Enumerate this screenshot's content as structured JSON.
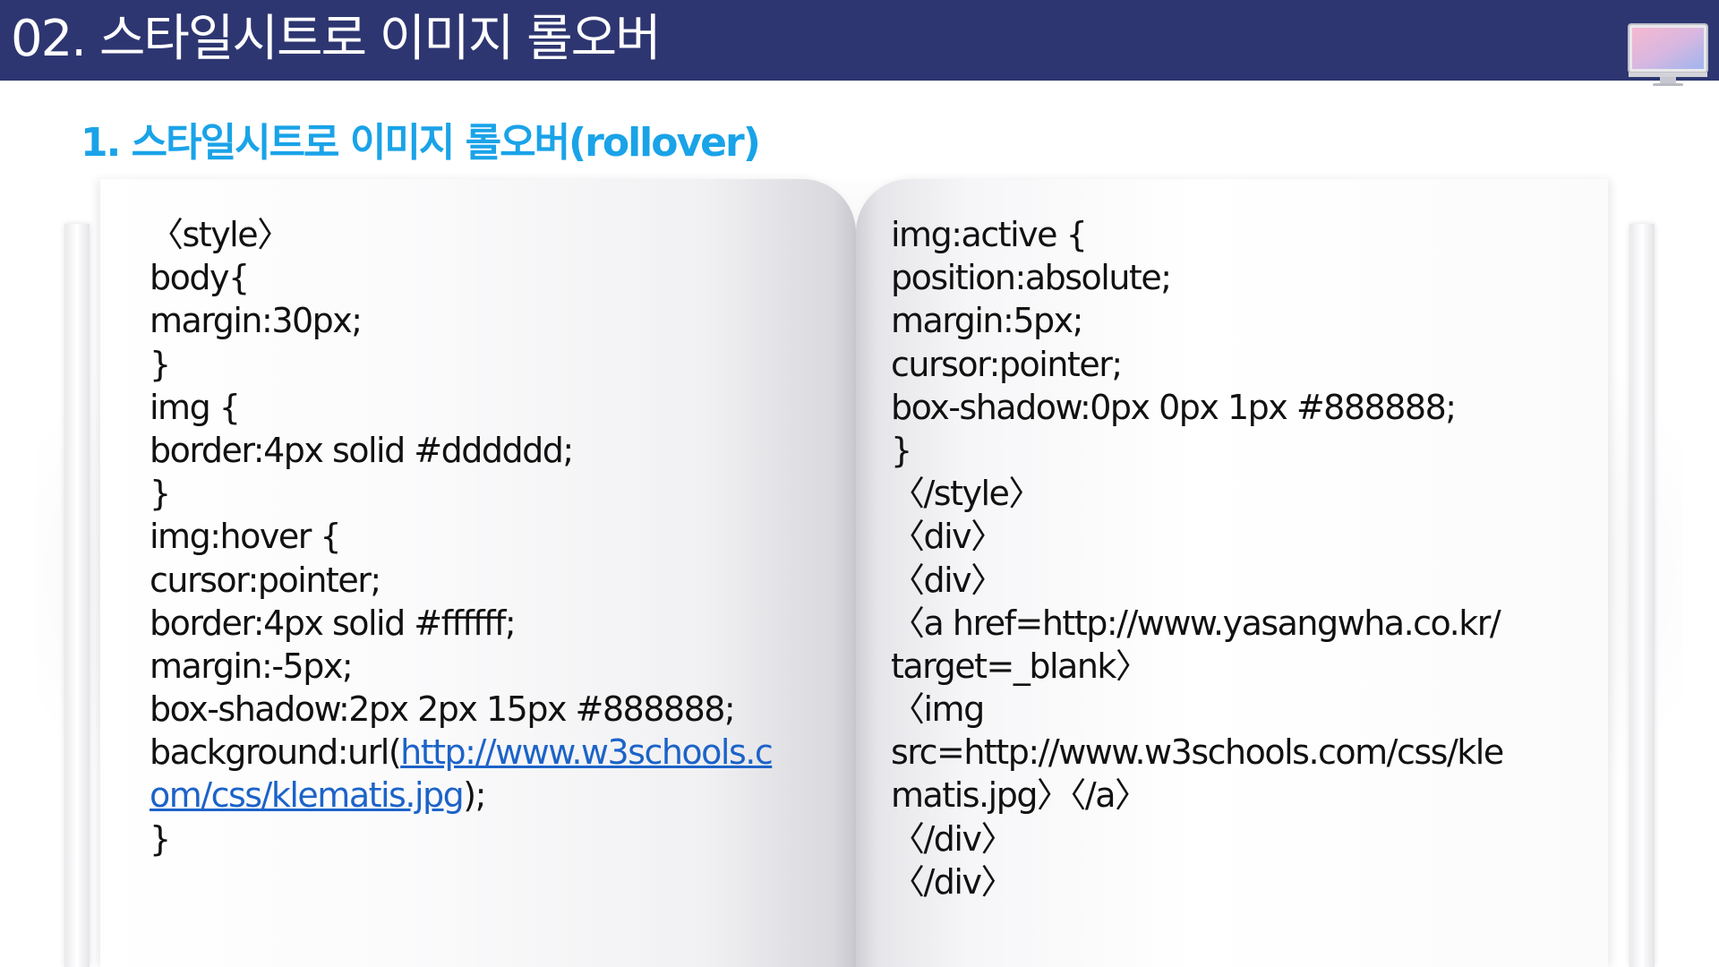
{
  "header": {
    "title": "02. 스타일시트로 이미지 롤오버",
    "icon": "monitor-icon"
  },
  "subtitle": "1. 스타일시트로 이미지 롤오버(rollover)",
  "colors": {
    "header_bg": "#2e3671",
    "subtitle": "#1aa3e8",
    "link": "#1c63c8"
  },
  "left_page": {
    "lines": [
      "〈style〉",
      "body{",
      "margin:30px;",
      "}",
      "img {",
      "border:4px solid #dddddd;",
      "}",
      "img:hover {",
      "cursor:pointer;",
      "border:4px solid #ffffff;",
      "margin:-5px;",
      "box-shadow:2px 2px 15px #888888;"
    ],
    "background_prefix": "background:url(",
    "link_part1": "http://www.w3schools.c",
    "link_part2": "om/css/klematis.jpg",
    "background_suffix": ");",
    "closing": "}"
  },
  "right_page": {
    "lines": [
      "img:active {",
      "position:absolute;",
      "margin:5px;",
      "cursor:pointer;",
      "box-shadow:0px 0px 1px #888888;",
      "}",
      "〈/style〉",
      "〈div〉",
      "〈div〉",
      "〈a href=http://www.yasangwha.co.kr/",
      "target=_blank〉",
      "〈img",
      "src=http://www.w3schools.com/css/kle",
      "matis.jpg〉〈/a〉",
      "〈/div〉",
      "〈/div〉"
    ]
  }
}
